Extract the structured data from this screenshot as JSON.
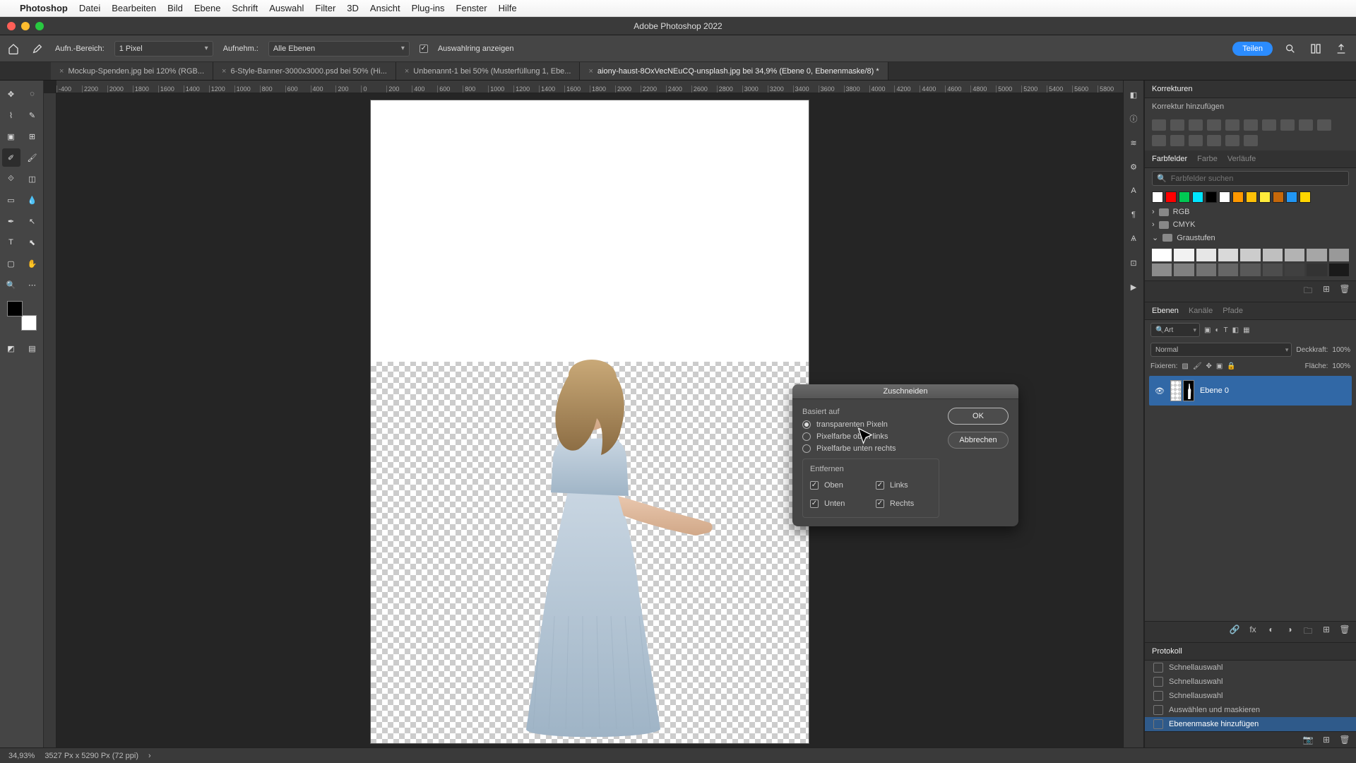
{
  "mac_menu": {
    "app": "Photoshop",
    "items": [
      "Datei",
      "Bearbeiten",
      "Bild",
      "Ebene",
      "Schrift",
      "Auswahl",
      "Filter",
      "3D",
      "Ansicht",
      "Plug-ins",
      "Fenster",
      "Hilfe"
    ]
  },
  "app_title": "Adobe Photoshop 2022",
  "options_bar": {
    "sample_area_label": "Aufn.-Bereich:",
    "sample_area_value": "1 Pixel",
    "sample_label": "Aufnehm.:",
    "sample_value": "Alle Ebenen",
    "show_ring_label": "Auswahlring anzeigen",
    "share_label": "Teilen"
  },
  "tabs": [
    "Mockup-Spenden.jpg bei 120% (RGB...",
    "6-Style-Banner-3000x3000.psd bei 50% (Hi...",
    "Unbenannt-1 bei 50% (Musterfüllung 1, Ebe...",
    "aiony-haust-8OxVecNEuCQ-unsplash.jpg bei 34,9% (Ebene 0, Ebenenmaske/8) *"
  ],
  "ruler_marks": [
    "-400",
    "2200",
    "2000",
    "1800",
    "1600",
    "1400",
    "1200",
    "1000",
    "800",
    "600",
    "400",
    "200",
    "0",
    "200",
    "400",
    "600",
    "800",
    "1000",
    "1200",
    "1400",
    "1600",
    "1800",
    "2000",
    "2200",
    "2400",
    "2600",
    "2800",
    "3000",
    "3200",
    "3400",
    "3600",
    "3800",
    "4000",
    "4200",
    "4400",
    "4600",
    "4800",
    "5000",
    "5200",
    "5400",
    "5600",
    "5800"
  ],
  "dialog": {
    "title": "Zuschneiden",
    "based_on_label": "Basiert auf",
    "radio_transparent": "transparenten Pixeln",
    "radio_topleft": "Pixelfarbe oben links",
    "radio_bottomright": "Pixelfarbe unten rechts",
    "remove_label": "Entfernen",
    "cb_top": "Oben",
    "cb_bottom": "Unten",
    "cb_left": "Links",
    "cb_right": "Rechts",
    "ok": "OK",
    "cancel": "Abbrechen"
  },
  "panels": {
    "adjustments_title": "Korrekturen",
    "adjustments_add": "Korrektur hinzufügen",
    "swatches_tabs": [
      "Farbfelder",
      "Farbe",
      "Verläufe"
    ],
    "swatch_search_placeholder": "Farbfelder suchen",
    "swatch_folders": [
      "RGB",
      "CMYK",
      "Graustufen"
    ],
    "layers_tabs": [
      "Ebenen",
      "Kanäle",
      "Pfade"
    ],
    "layer_filter": "Art",
    "blend_mode": "Normal",
    "opacity_label": "Deckkraft:",
    "opacity_value": "100%",
    "lock_label": "Fixieren:",
    "fill_label": "Fläche:",
    "fill_value": "100%",
    "layer_name": "Ebene 0",
    "history_title": "Protokoll",
    "history_items": [
      "Schnellauswahl",
      "Schnellauswahl",
      "Schnellauswahl",
      "Auswählen und maskieren",
      "Ebenenmaske hinzufügen"
    ]
  },
  "swatch_colors_basic": [
    "#ffffff",
    "#ff0000",
    "#00c853",
    "#00e5ff",
    "#000000",
    "#ffffff",
    "#ff9800",
    "#ffc107",
    "#ffeb3b",
    "#c6680a",
    "#2196f3",
    "#ffd600"
  ],
  "gray_shades": [
    "#ffffff",
    "#f2f2f2",
    "#e6e6e6",
    "#d9d9d9",
    "#cccccc",
    "#bfbfbf",
    "#b3b3b3",
    "#a6a6a6",
    "#999999",
    "#8c8c8c",
    "#808080",
    "#737373",
    "#666666",
    "#595959",
    "#4d4d4d",
    "#404040",
    "#333333",
    "#1a1a1a"
  ],
  "status": {
    "zoom": "34,93%",
    "doc_info": "3527 Px x 5290 Px (72 ppi)"
  }
}
